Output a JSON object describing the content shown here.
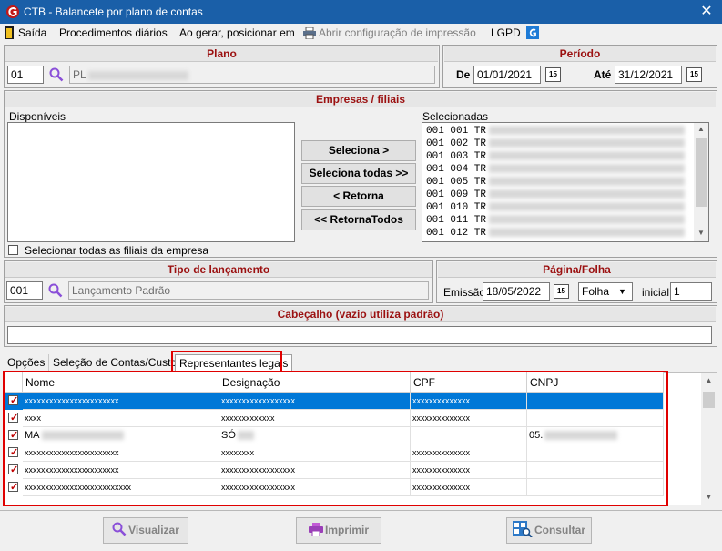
{
  "window": {
    "title": "CTB - Balancete por plano de contas",
    "close_glyph": "✕"
  },
  "menu": {
    "items": [
      {
        "label": "Saída"
      },
      {
        "label": "Procedimentos diários"
      },
      {
        "label": "Ao gerar, posicionar em"
      },
      {
        "label": "Abrir configuração de impressão"
      },
      {
        "label": "LGPD"
      }
    ]
  },
  "plano": {
    "header": "Plano",
    "code": "01",
    "description": "PL"
  },
  "periodo": {
    "header": "Período",
    "de_label": "De",
    "de_value": "01/01/2021",
    "ate_label": "Até",
    "ate_value": "31/12/2021",
    "calendar_glyph": "15"
  },
  "empresas": {
    "header": "Empresas / filiais",
    "disponiveis_label": "Disponíveis",
    "selecionadas_label": "Selecionadas",
    "buttons": {
      "seleciona": "Seleciona >",
      "seleciona_todas": "Seleciona todas >>",
      "retorna": "< Retorna",
      "retorna_todos": "<< RetornaTodos"
    },
    "selecionadas": [
      {
        "code": "001 001 TR"
      },
      {
        "code": "001 002 TR"
      },
      {
        "code": "001 003 TR"
      },
      {
        "code": "001 004 TR"
      },
      {
        "code": "001 005 TR"
      },
      {
        "code": "001 009 TR"
      },
      {
        "code": "001 010 TR"
      },
      {
        "code": "001 011 TR"
      },
      {
        "code": "001 012 TR"
      }
    ],
    "select_all_label": "Selecionar todas as filiais da empresa"
  },
  "tipo_lancamento": {
    "header": "Tipo de lançamento",
    "code": "001",
    "description": "Lançamento Padrão"
  },
  "pagina": {
    "header": "Página/Folha",
    "emissao_label": "Emissão",
    "emissao_value": "18/05/2022",
    "tipo_value": "Folha",
    "inicial_label": "inicial",
    "inicial_value": "1"
  },
  "cabecalho": {
    "header": "Cabeçalho (vazio utiliza padrão)",
    "value": ""
  },
  "tabs": [
    {
      "label": "Opções"
    },
    {
      "label": "Seleção de Contas/Custos"
    },
    {
      "label": "Representantes legais"
    }
  ],
  "grid": {
    "columns": [
      "Nome",
      "Designação",
      "CPF",
      "CNPJ"
    ],
    "rows": [
      {
        "nome": "xxxxxxxxxxxxxxxxxxxxxxx",
        "designacao": "xxxxxxxxxxxxxxxxxx",
        "cpf": "xxxxxxxxxxxxxx",
        "cnpj": ""
      },
      {
        "nome": "xxxx",
        "designacao": "xxxxxxxxxxxxx",
        "cpf": "xxxxxxxxxxxxxx",
        "cnpj": ""
      },
      {
        "nome": "MA",
        "designacao": "SÓ",
        "cpf": "",
        "cnpj": "05."
      },
      {
        "nome": "xxxxxxxxxxxxxxxxxxxxxxx",
        "designacao": "xxxxxxxx",
        "cpf": "xxxxxxxxxxxxxx",
        "cnpj": ""
      },
      {
        "nome": "xxxxxxxxxxxxxxxxxxxxxxx",
        "designacao": "xxxxxxxxxxxxxxxxxx",
        "cpf": "xxxxxxxxxxxxxx",
        "cnpj": ""
      },
      {
        "nome": "xxxxxxxxxxxxxxxxxxxxxxxxxx",
        "designacao": "xxxxxxxxxxxxxxxxxx",
        "cpf": "xxxxxxxxxxxxxx",
        "cnpj": ""
      }
    ]
  },
  "actions": {
    "visualizar": "Visualizar",
    "imprimir": "Imprimir",
    "consultar": "Consultar"
  },
  "colors": {
    "title_bar": "#1a5fa8",
    "header_text": "#9b1010",
    "selection": "#0078d7",
    "highlight_box": "#e00000"
  }
}
